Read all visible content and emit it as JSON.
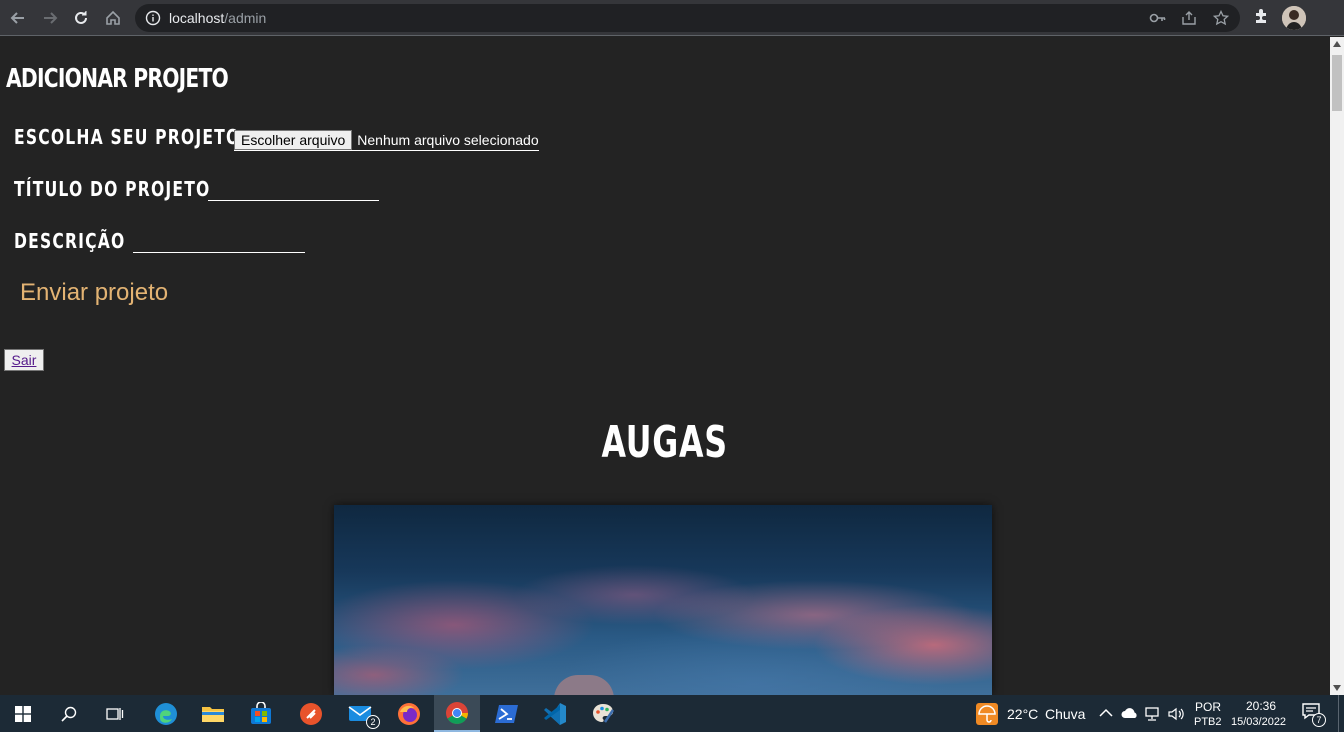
{
  "browser": {
    "url_host": "localhost",
    "url_path": "/admin"
  },
  "page": {
    "heading": "ADICIONAR PROJETO",
    "form": {
      "file_label": "ESCOLHA SEU PROJETO",
      "file_button": "Escolher arquivo",
      "file_status": "Nenhum arquivo selecionado",
      "title_label": "TÍTULO DO PROJETO",
      "title_value": "",
      "description_label": "DESCRIÇÃO",
      "description_value": "",
      "submit_label": "Enviar projeto"
    },
    "logout_label": "Sair",
    "project": {
      "title": "AUGAS"
    }
  },
  "taskbar": {
    "apps": [
      "start",
      "search",
      "task-view",
      "edge",
      "file-explorer",
      "microsoft-store",
      "app-red",
      "mail",
      "firefox",
      "chrome",
      "powershell",
      "vscode",
      "paint"
    ],
    "mail_badge": "2",
    "weather": {
      "temp": "22°C",
      "condition": "Chuva"
    },
    "language": {
      "lang": "POR",
      "layout": "PTB2"
    },
    "clock": {
      "time": "20:36",
      "date": "15/03/2022"
    },
    "notifications": "7"
  },
  "colors": {
    "page_bg": "#232323",
    "accent_submit": "#e3b373",
    "taskbar_bg": "#1c2a36"
  }
}
